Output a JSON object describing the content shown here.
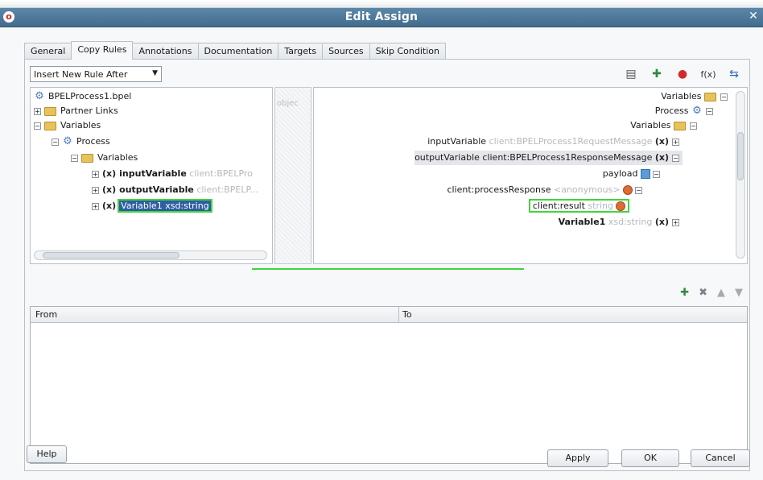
{
  "dialog": {
    "title": "Edit Assign"
  },
  "tabs": [
    {
      "label": "General"
    },
    {
      "label": "Copy Rules"
    },
    {
      "label": "Annotations"
    },
    {
      "label": "Documentation"
    },
    {
      "label": "Targets"
    },
    {
      "label": "Sources"
    },
    {
      "label": "Skip Condition"
    }
  ],
  "rule_combo": {
    "value": "Insert New Rule After"
  },
  "source_tree": {
    "gutter_ghost": "objec",
    "nodes": [
      {
        "label": "BPELProcess1.bpel"
      },
      {
        "label": "Partner Links"
      },
      {
        "label": "Variables"
      },
      {
        "label": "Process"
      },
      {
        "label": "Variables"
      },
      {
        "label": "inputVariable",
        "meta": "client:BPELPro"
      },
      {
        "label": "outputVariable",
        "meta": "client:BPELP..."
      },
      {
        "label": "Variable1",
        "meta": "xsd:string"
      }
    ]
  },
  "target_tree": {
    "nodes": [
      {
        "label": "Variables"
      },
      {
        "label": "Process"
      },
      {
        "label": "Variables"
      },
      {
        "label": "inputVariable",
        "meta": "client:BPELProcess1RequestMessage"
      },
      {
        "label": "outputVariable client:BPELProcess1ResponseMessage"
      },
      {
        "label": "payload"
      },
      {
        "label": "client:processResponse",
        "meta": "<anonymous>"
      },
      {
        "label": "client:result",
        "meta": "string"
      },
      {
        "label": "Variable1",
        "meta": "xsd:string"
      }
    ]
  },
  "rules_table": {
    "col_from": "From",
    "col_to": "To",
    "rows": []
  },
  "buttons": {
    "help": "Help",
    "apply": "Apply",
    "ok": "OK",
    "cancel": "Cancel"
  },
  "colors": {
    "titlebar": "#4a7596",
    "mapping_line": "#41d53b",
    "selection": "#2f5ea2"
  }
}
